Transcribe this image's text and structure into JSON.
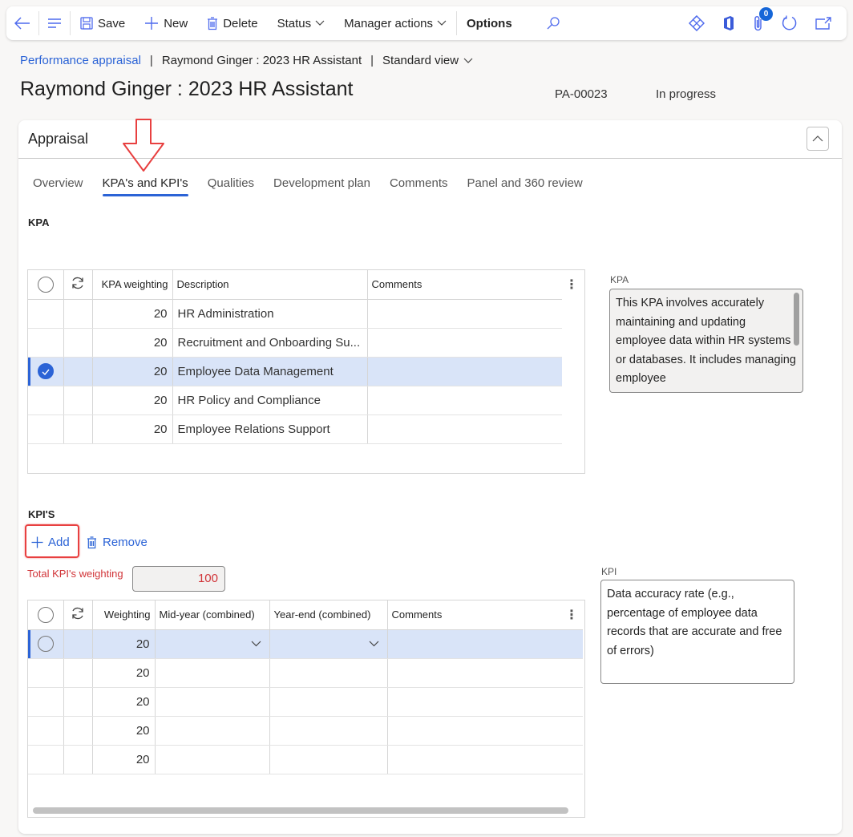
{
  "toolbar": {
    "save": "Save",
    "new": "New",
    "delete": "Delete",
    "status": "Status",
    "manager_actions": "Manager actions",
    "options": "Options",
    "attachments_count": "0"
  },
  "breadcrumb": {
    "module": "Performance appraisal",
    "record": "Raymond Ginger : 2023 HR Assistant",
    "view": "Standard view"
  },
  "header": {
    "title": "Raymond Ginger : 2023 HR Assistant",
    "record_id": "PA-00023",
    "status": "In progress"
  },
  "card": {
    "title": "Appraisal",
    "tabs": [
      {
        "label": "Overview",
        "active": false
      },
      {
        "label": "KPA's and KPI's",
        "active": true
      },
      {
        "label": "Qualities",
        "active": false
      },
      {
        "label": "Development plan",
        "active": false
      },
      {
        "label": "Comments",
        "active": false
      },
      {
        "label": "Panel and 360 review",
        "active": false
      }
    ]
  },
  "kpa": {
    "section_label": "KPA",
    "columns": [
      "KPA weighting",
      "Description",
      "Comments"
    ],
    "rows": [
      {
        "weighting": "20",
        "description": "HR Administration",
        "comments": "",
        "selected": false
      },
      {
        "weighting": "20",
        "description": "Recruitment and Onboarding Su...",
        "comments": "",
        "selected": false
      },
      {
        "weighting": "20",
        "description": "Employee Data Management",
        "comments": "",
        "selected": true
      },
      {
        "weighting": "20",
        "description": "HR Policy and Compliance",
        "comments": "",
        "selected": false
      },
      {
        "weighting": "20",
        "description": "Employee Relations Support",
        "comments": "",
        "selected": false
      }
    ],
    "detail_label": "KPA",
    "detail_text": "This KPA involves accurately maintaining and updating employee data within HR systems or databases. It includes managing employee"
  },
  "kpi": {
    "section_label": "KPI'S",
    "add": "Add",
    "remove": "Remove",
    "total_label": "Total KPI's weighting",
    "total_value": "100",
    "columns": [
      "Weighting",
      "Mid-year (combined)",
      "Year-end (combined)",
      "Comments"
    ],
    "rows": [
      {
        "weighting": "20",
        "mid_year": "",
        "year_end": "",
        "comments": "",
        "selected": true
      },
      {
        "weighting": "20",
        "mid_year": "",
        "year_end": "",
        "comments": "",
        "selected": false
      },
      {
        "weighting": "20",
        "mid_year": "",
        "year_end": "",
        "comments": "",
        "selected": false
      },
      {
        "weighting": "20",
        "mid_year": "",
        "year_end": "",
        "comments": "",
        "selected": false
      },
      {
        "weighting": "20",
        "mid_year": "",
        "year_end": "",
        "comments": "",
        "selected": false
      }
    ],
    "detail_label": "KPI",
    "detail_text": "Data accuracy rate (e.g., percentage of employee data records that are accurate and free of errors)"
  },
  "colors": {
    "accent": "#2b63d6",
    "selected_row": "#d9e4f8",
    "error_text": "#d13438",
    "annotation": "#e84040"
  }
}
